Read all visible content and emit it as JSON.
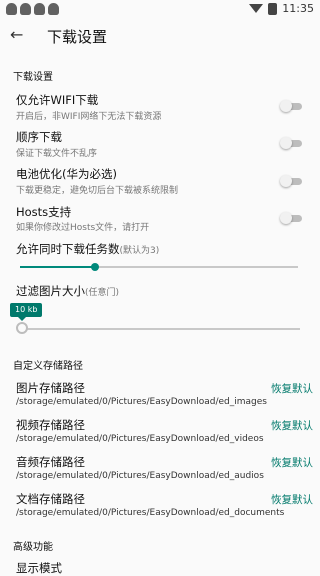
{
  "status_bar": {
    "time": "11:35"
  },
  "app_bar": {
    "title": "下载设置"
  },
  "sections": {
    "download": "下载设置",
    "custom_path": "自定义存储路径",
    "advanced": "高级功能"
  },
  "toggles": [
    {
      "title": "仅允许WIFI下载",
      "subtitle": "开启后，非WIFI网络下无法下载资源",
      "on": false
    },
    {
      "title": "顺序下载",
      "subtitle": "保证下载文件不乱序",
      "on": false
    },
    {
      "title": "电池优化(华为必选)",
      "subtitle": "下载更稳定，避免切后台下载被系统限制",
      "on": false
    },
    {
      "title": "Hosts支持",
      "subtitle": "如果你修改过Hosts文件，请打开",
      "on": false
    }
  ],
  "sliders": {
    "concurrent": {
      "label": "允许同时下载任务数",
      "hint": "(默认为3)",
      "value_fraction": 0.27
    },
    "filter": {
      "label": "过滤图片大小",
      "hint": "(任意门)",
      "bubble": "10 kb",
      "value_fraction": 0.0
    }
  },
  "paths": [
    {
      "title": "图片存储路径",
      "path": "/storage/emulated/0/Pictures/EasyDownload/ed_images",
      "action": "恢复默认"
    },
    {
      "title": "视频存储路径",
      "path": "/storage/emulated/0/Pictures/EasyDownload/ed_videos",
      "action": "恢复默认"
    },
    {
      "title": "音频存储路径",
      "path": "/storage/emulated/0/Pictures/EasyDownload/ed_audios",
      "action": "恢复默认"
    },
    {
      "title": "文档存储路径",
      "path": "/storage/emulated/0/Pictures/EasyDownload/ed_documents",
      "action": "恢复默认"
    }
  ],
  "advanced_items": [
    {
      "title": "显示模式"
    }
  ],
  "colors": {
    "accent": "#00897b",
    "background": "#fafafa"
  }
}
